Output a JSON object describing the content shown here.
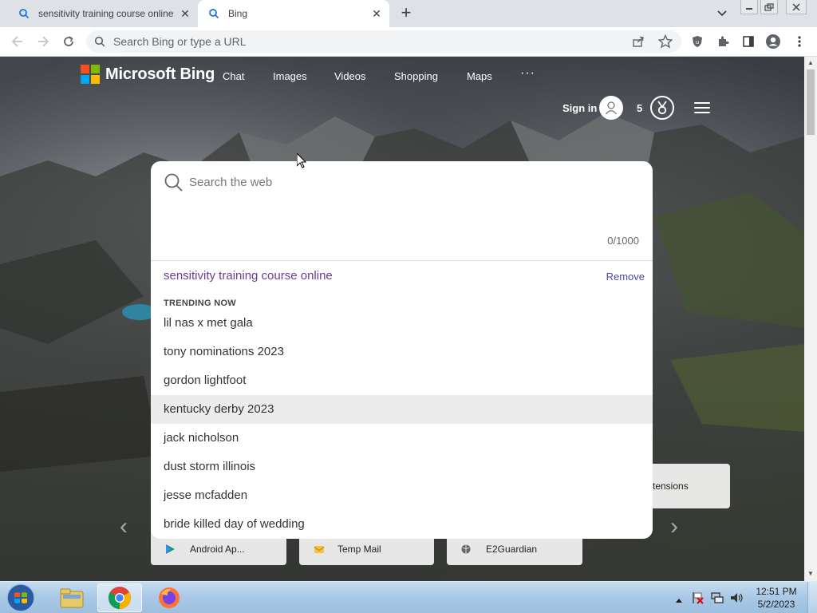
{
  "browser": {
    "tabs": [
      {
        "title": "sensitivity training course online",
        "active": false
      },
      {
        "title": "Bing",
        "active": true
      }
    ],
    "omnibox_placeholder": "Search Bing or type a URL"
  },
  "bing": {
    "logo_text": "Microsoft Bing",
    "nav": [
      "Chat",
      "Images",
      "Videos",
      "Shopping",
      "Maps"
    ],
    "nav_more": "···",
    "sign_in": "Sign in",
    "points": "5",
    "logo_colors": [
      "#f25022",
      "#7fba00",
      "#00a4ef",
      "#ffb900"
    ]
  },
  "search": {
    "placeholder": "Search the web",
    "char_count": "0/1000",
    "recent": "sensitivity training course online",
    "remove_label": "Remove",
    "trending_header": "TRENDING NOW",
    "suggestions": [
      "lil nas x met gala",
      "tony nominations 2023",
      "gordon lightfoot",
      "kentucky derby 2023",
      "jack nicholson",
      "dust storm illinois",
      "jesse mcfadden",
      "bride killed day of wedding"
    ],
    "highlighted_index": 3
  },
  "quick_links": {
    "tiles": [
      "Android Ap...",
      "Temp Mail",
      "E2Guardian"
    ],
    "extra_partial": "tensions"
  },
  "taskbar": {
    "time": "12:51 PM",
    "date": "5/2/2023"
  }
}
